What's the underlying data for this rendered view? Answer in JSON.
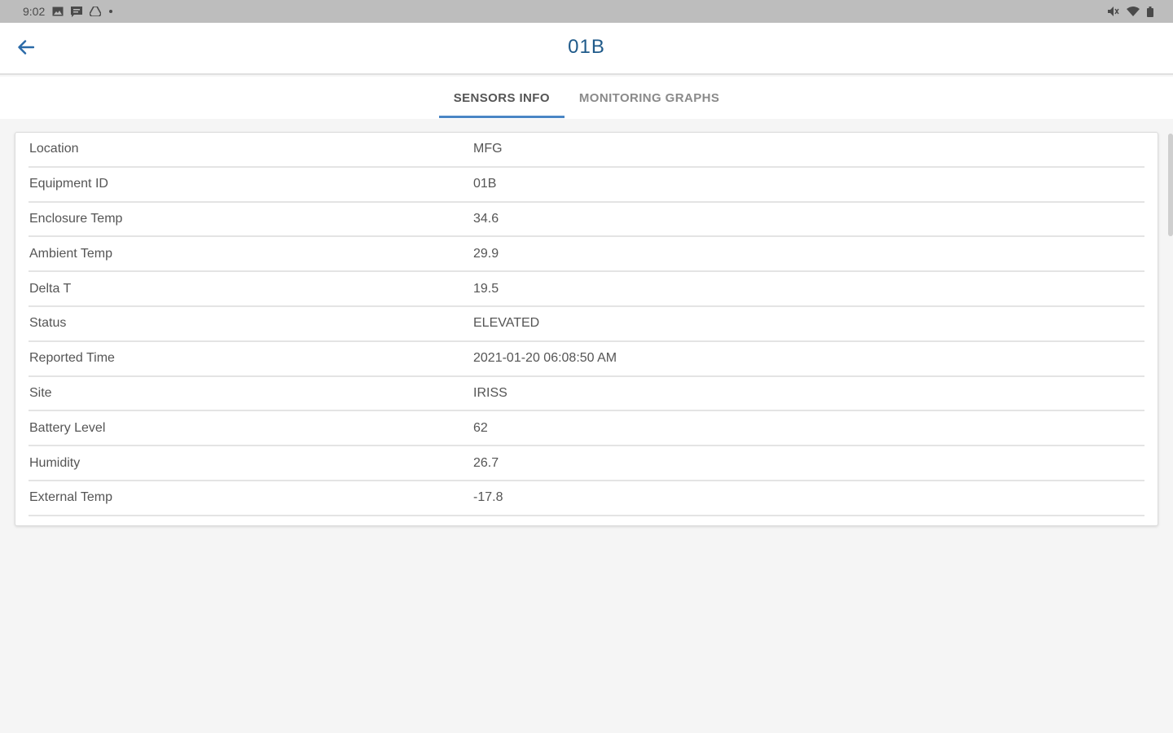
{
  "status_bar": {
    "time": "9:02",
    "left_icons": [
      "gallery-icon",
      "message-icon",
      "drive-icon",
      "dot-icon"
    ],
    "right_icons": [
      "mute-icon",
      "wifi-icon",
      "battery-icon"
    ]
  },
  "header": {
    "title": "01B",
    "back_icon": "arrow-left-icon"
  },
  "tabs": [
    {
      "label": "SENSORS INFO",
      "active": true
    },
    {
      "label": "MONITORING GRAPHS",
      "active": false
    }
  ],
  "sensor_info": [
    {
      "label": "Location",
      "value": "MFG"
    },
    {
      "label": "Equipment ID",
      "value": "01B"
    },
    {
      "label": "Enclosure Temp",
      "value": "34.6"
    },
    {
      "label": "Ambient Temp",
      "value": "29.9"
    },
    {
      "label": "Delta T",
      "value": "19.5"
    },
    {
      "label": "Status",
      "value": "ELEVATED"
    },
    {
      "label": "Reported Time",
      "value": "2021-01-20 06:08:50 AM"
    },
    {
      "label": "Site",
      "value": "IRISS"
    },
    {
      "label": "Battery Level",
      "value": "62"
    },
    {
      "label": "Humidity",
      "value": "26.7"
    },
    {
      "label": "External Temp",
      "value": "-17.8"
    }
  ],
  "colors": {
    "accent": "#4a86c5",
    "title": "#1f5a8a",
    "status_bar": "#bdbdbd"
  }
}
